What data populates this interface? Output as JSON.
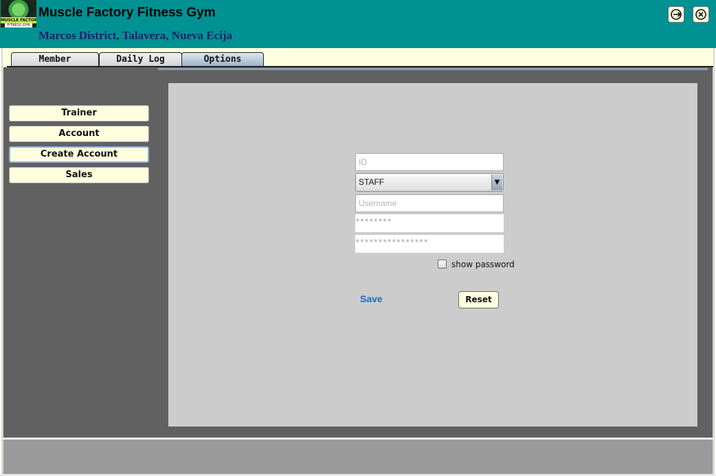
{
  "header": {
    "logo_text_top": "MUSCLE FACTORY",
    "logo_text_bottom": "FITNESS GYM",
    "title": "Muscle Factory Fitness Gym",
    "subtitle": "Marcos District, Talavera, Nueva Ecija",
    "logout_icon": "logout-icon",
    "close_icon": "close-icon"
  },
  "tabs": [
    {
      "label": "Member",
      "active": false
    },
    {
      "label": "Daily Log",
      "active": false
    },
    {
      "label": "Options",
      "active": true
    }
  ],
  "sidebar": {
    "items": [
      {
        "label": "Trainer",
        "selected": false
      },
      {
        "label": "Account",
        "selected": false
      },
      {
        "label": "Create Account",
        "selected": true
      },
      {
        "label": "Sales",
        "selected": false
      }
    ]
  },
  "form": {
    "id_placeholder": "ID",
    "role_selected": "STAFF",
    "username_placeholder": "Username",
    "password_placeholder": "********",
    "confirm_password_placeholder": "****************",
    "show_password_label": "show password",
    "show_password_checked": false,
    "save_label": "Save",
    "reset_label": "Reset"
  },
  "colors": {
    "header_bg": "#009193",
    "tabbar_bg": "#ffffe0",
    "main_bg": "#616161",
    "panel_bg": "#cccccc",
    "save_link": "#1d64d2"
  }
}
